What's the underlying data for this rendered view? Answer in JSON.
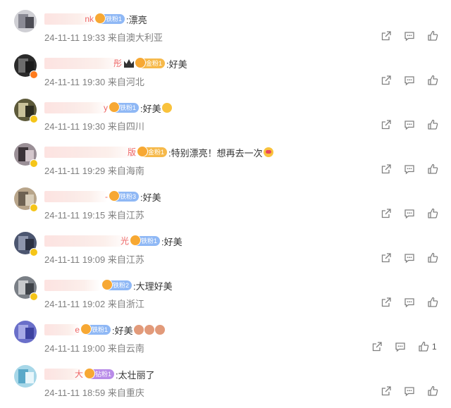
{
  "comments": [
    {
      "name_tail": "nk",
      "badge": "铁粉1",
      "badge_style": "blue",
      "text": ":漂亮",
      "time": "24-11-11 19:33",
      "location": "来自澳大利亚",
      "emoji": [],
      "like": ""
    },
    {
      "name_tail": "彤",
      "badge": "金粉1",
      "badge_style": "gold",
      "crown": true,
      "text": ":好美",
      "time": "24-11-11 19:30",
      "location": "来自河北",
      "emoji": [],
      "like": ""
    },
    {
      "name_tail": "y",
      "badge": "铁粉1",
      "badge_style": "blue",
      "text": ":好美",
      "time": "24-11-11 19:30",
      "location": "来自四川",
      "emoji": [
        "wow"
      ],
      "like": ""
    },
    {
      "name_tail": "版",
      "badge": "金粉1",
      "badge_style": "gold",
      "text": ":特别漂亮！想再去一次",
      "time": "24-11-11 19:29",
      "location": "来自海南",
      "emoji": [
        "heart-eyes"
      ],
      "like": ""
    },
    {
      "name_tail": "-",
      "badge": "铁粉3",
      "badge_style": "blue",
      "text": ":好美",
      "time": "24-11-11 19:15",
      "location": "来自江苏",
      "emoji": [],
      "like": ""
    },
    {
      "name_tail": "光",
      "badge": "铁粉1",
      "badge_style": "blue",
      "text": ":好美",
      "time": "24-11-11 19:09",
      "location": "来自江苏",
      "emoji": [],
      "like": ""
    },
    {
      "name_tail": "",
      "badge": "铁粉2",
      "badge_style": "blue",
      "text": ":大理好美",
      "time": "24-11-11 19:02",
      "location": "来自浙江",
      "emoji": [],
      "like": ""
    },
    {
      "name_tail": "e",
      "badge": "铁粉1",
      "badge_style": "blue",
      "text": ":好美",
      "time": "24-11-11 19:00",
      "location": "来自云南",
      "emoji": [
        "bear",
        "bear",
        "bear"
      ],
      "like": "1"
    },
    {
      "name_tail": "大",
      "badge": "钻粉1",
      "badge_style": "purple",
      "text": ":太壮丽了",
      "time": "24-11-11 18:59",
      "location": "来自重庆",
      "emoji": [],
      "like": ""
    }
  ]
}
